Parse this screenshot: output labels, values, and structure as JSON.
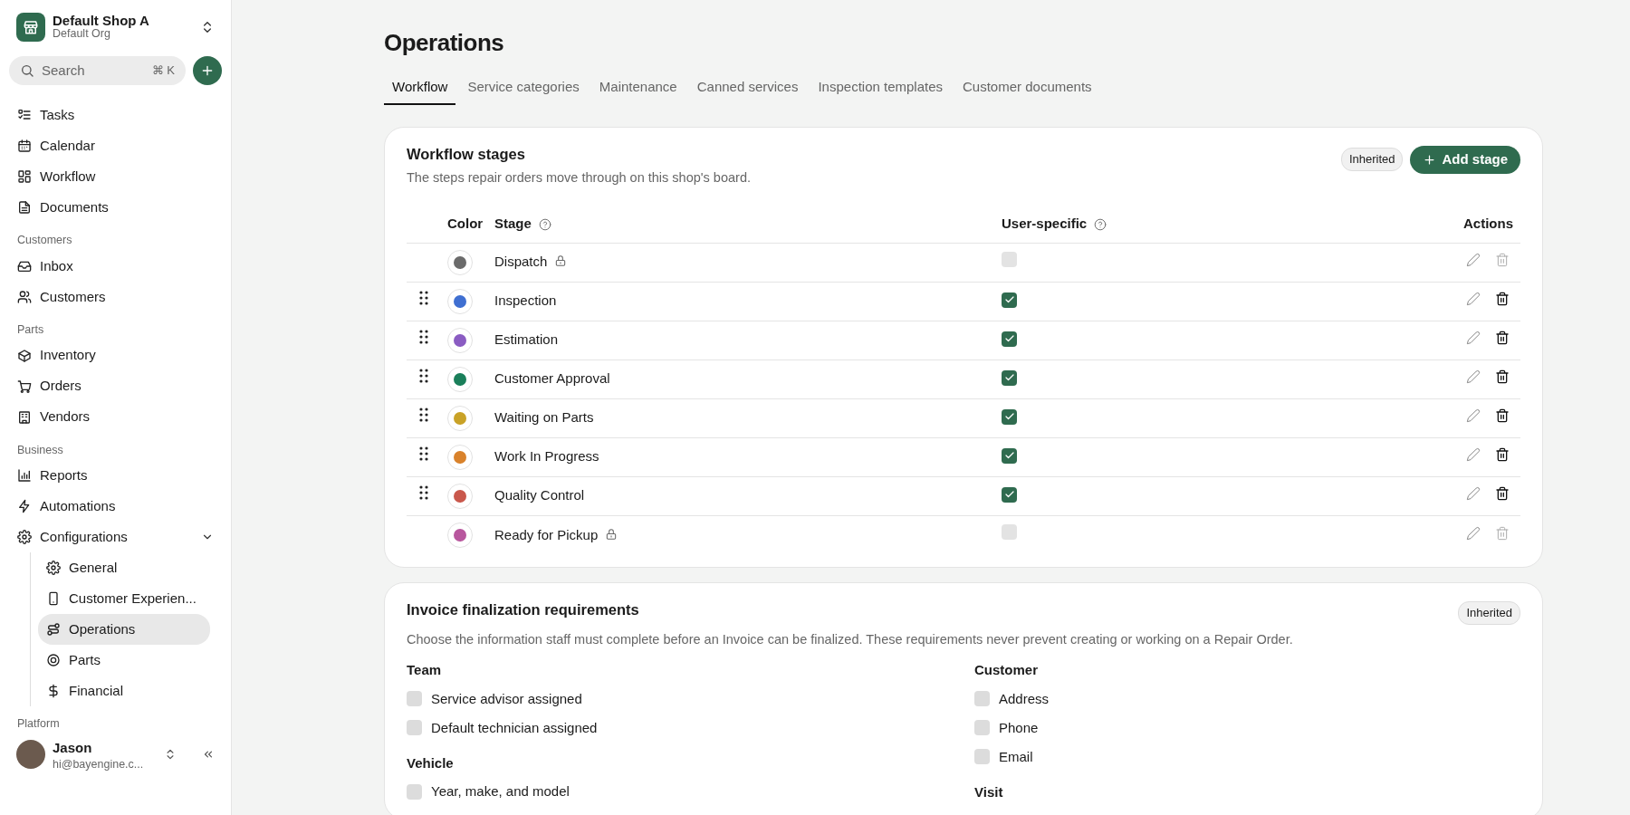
{
  "sidebar": {
    "shop": {
      "name": "Default Shop A",
      "org": "Default Org"
    },
    "search": {
      "placeholder": "Search",
      "shortcut": "⌘ K"
    },
    "sections": [
      {
        "items": [
          {
            "label": "Tasks",
            "selected": false
          },
          {
            "label": "Calendar",
            "selected": false
          },
          {
            "label": "Workflow",
            "selected": false
          },
          {
            "label": "Documents",
            "selected": false
          }
        ]
      },
      {
        "label": "Customers",
        "items": [
          {
            "label": "Inbox",
            "selected": false
          },
          {
            "label": "Customers",
            "selected": false
          }
        ]
      },
      {
        "label": "Parts",
        "items": [
          {
            "label": "Inventory",
            "selected": false
          },
          {
            "label": "Orders",
            "selected": false
          },
          {
            "label": "Vendors",
            "selected": false
          }
        ]
      },
      {
        "label": "Business",
        "items": [
          {
            "label": "Reports",
            "selected": false
          },
          {
            "label": "Automations",
            "selected": false
          },
          {
            "label": "Configurations",
            "selected": false,
            "expanded": true,
            "children": [
              {
                "label": "General",
                "selected": false
              },
              {
                "label": "Customer Experien...",
                "selected": false
              },
              {
                "label": "Operations",
                "selected": true
              },
              {
                "label": "Parts",
                "selected": false
              },
              {
                "label": "Financial",
                "selected": false
              }
            ]
          }
        ]
      },
      {
        "label": "Platform"
      }
    ],
    "user": {
      "name": "Jason",
      "email": "hi@bayengine.c..."
    }
  },
  "page": {
    "title": "Operations",
    "tabs": [
      {
        "label": "Workflow",
        "selected": true
      },
      {
        "label": "Service categories",
        "selected": false
      },
      {
        "label": "Maintenance",
        "selected": false
      },
      {
        "label": "Canned services",
        "selected": false
      },
      {
        "label": "Inspection templates",
        "selected": false
      },
      {
        "label": "Customer documents",
        "selected": false
      }
    ]
  },
  "workflow_stages": {
    "title": "Workflow stages",
    "description": "The steps repair orders move through on this shop's board.",
    "badge": "Inherited",
    "add_button": "Add stage",
    "columns": [
      "Color",
      "Stage",
      "User-specific",
      "Actions"
    ],
    "rows": [
      {
        "stage": "Dispatch",
        "color": "#6b6b6b",
        "locked": true,
        "user_specific": false
      },
      {
        "stage": "Inspection",
        "color": "#3f6fd1",
        "locked": false,
        "user_specific": true
      },
      {
        "stage": "Estimation",
        "color": "#8a5cc2",
        "locked": false,
        "user_specific": true
      },
      {
        "stage": "Customer Approval",
        "color": "#1a7f5a",
        "locked": false,
        "user_specific": true
      },
      {
        "stage": "Waiting on Parts",
        "color": "#c9a227",
        "locked": false,
        "user_specific": true
      },
      {
        "stage": "Work In Progress",
        "color": "#d9822b",
        "locked": false,
        "user_specific": true
      },
      {
        "stage": "Quality Control",
        "color": "#c9584c",
        "locked": false,
        "user_specific": true
      },
      {
        "stage": "Ready for Pickup",
        "color": "#b8579e",
        "locked": true,
        "user_specific": false
      }
    ]
  },
  "invoice_requirements": {
    "title": "Invoice finalization requirements",
    "badge": "Inherited",
    "description": "Choose the information staff must complete before an Invoice can be finalized. These requirements never prevent creating or working on a Repair Order.",
    "columns": [
      [
        {
          "label": "Team",
          "items": [
            {
              "label": "Service advisor assigned",
              "checked": false
            },
            {
              "label": "Default technician assigned",
              "checked": false
            }
          ]
        },
        {
          "label": "Vehicle",
          "items": [
            {
              "label": "Year, make, and model",
              "checked": false
            }
          ]
        }
      ],
      [
        {
          "label": "Customer",
          "items": [
            {
              "label": "Address",
              "checked": false
            },
            {
              "label": "Phone",
              "checked": false
            },
            {
              "label": "Email",
              "checked": false
            }
          ]
        },
        {
          "label": "Visit"
        }
      ]
    ]
  }
}
